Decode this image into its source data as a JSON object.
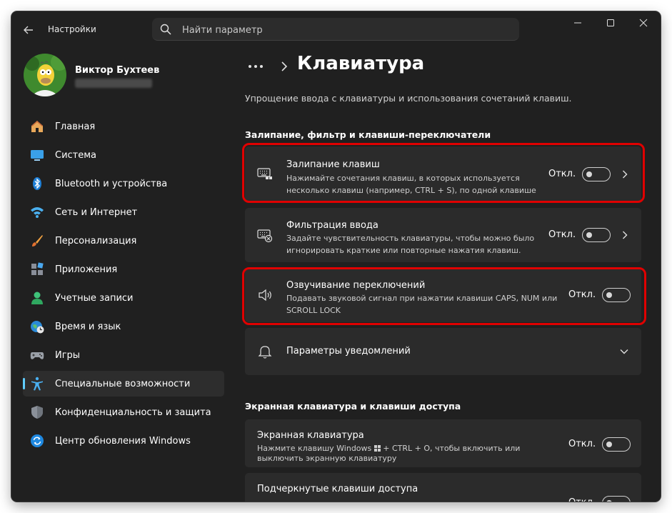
{
  "app": {
    "title": "Настройки",
    "search_placeholder": "Найти параметр"
  },
  "user": {
    "name": "Виктор Бухтеев"
  },
  "nav": [
    {
      "label": "Главная",
      "icon": "home-icon"
    },
    {
      "label": "Система",
      "icon": "system-icon"
    },
    {
      "label": "Bluetooth и устройства",
      "icon": "bluetooth-icon"
    },
    {
      "label": "Сеть и Интернет",
      "icon": "wifi-icon"
    },
    {
      "label": "Персонализация",
      "icon": "brush-icon"
    },
    {
      "label": "Приложения",
      "icon": "apps-icon"
    },
    {
      "label": "Учетные записи",
      "icon": "account-icon"
    },
    {
      "label": "Время и язык",
      "icon": "globe-clock-icon"
    },
    {
      "label": "Игры",
      "icon": "gamepad-icon"
    },
    {
      "label": "Специальные возможности",
      "icon": "accessibility-icon",
      "active": true
    },
    {
      "label": "Конфиденциальность и защита",
      "icon": "shield-icon"
    },
    {
      "label": "Центр обновления Windows",
      "icon": "update-icon"
    }
  ],
  "page": {
    "title": "Клавиатура",
    "subtitle": "Упрощение ввода с клавиатуры и использования сочетаний клавиш."
  },
  "sections": {
    "filter_title": "Залипание, фильтр и клавиши-переключатели",
    "onscreen_title": "Экранная клавиатура и клавиши доступа"
  },
  "cards": {
    "sticky": {
      "title": "Залипание клавиш",
      "desc1": "Нажимайте сочетания клавиш, в которых используется",
      "desc2": "несколько клавиш (например, CTRL + S), по одной клавише",
      "state": "Откл."
    },
    "filter": {
      "title": "Фильтрация ввода",
      "desc1": "Задайте чувствительность клавиатуры, чтобы можно было",
      "desc2": "игнорировать краткие или повторные нажатия клавиш.",
      "state": "Откл."
    },
    "toggle_keys": {
      "title": "Озвучивание переключений",
      "desc1": "Подавать звуковой сигнал при нажатии клавиши CAPS, NUM или",
      "desc2": "SCROLL LOCK",
      "state": "Откл."
    },
    "notify": {
      "title": "Параметры уведомлений"
    },
    "osk": {
      "title": "Экранная клавиатура",
      "desc1a": "Нажмите клавишу Windows",
      "desc1b": "+ CTRL + O, чтобы включить или",
      "desc2": "выключить экранную клавиатуру",
      "state": "Откл."
    },
    "underline": {
      "title": "Подчеркнутые клавиши доступа",
      "state": "Откл."
    }
  },
  "colors": {
    "window_bg": "#202020",
    "card_bg": "#2b2b2b",
    "accent": "#60cdff",
    "highlight": "#e00000"
  }
}
